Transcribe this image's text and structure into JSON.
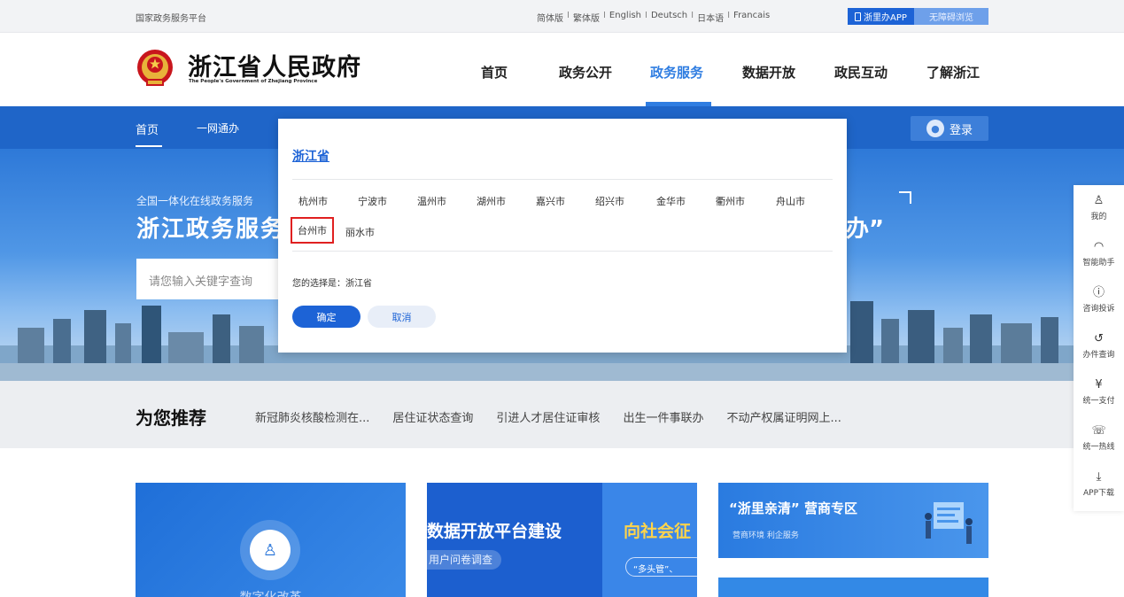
{
  "topbar": {
    "platform": "国家政务服务平台",
    "languages": [
      "简体版",
      "繁体版",
      "English",
      "Deutsch",
      "日本语",
      "Francais"
    ],
    "separator": "I",
    "app_label": "浙里办APP",
    "access_label": "无障碍浏览"
  },
  "header": {
    "site_name": "浙江省人民政府",
    "site_name_en": "The People's Government of Zhejiang Province",
    "nav": [
      "首页",
      "政务公开",
      "政务服务",
      "数据开放",
      "政民互动",
      "了解浙江"
    ],
    "active_nav": "政务服务"
  },
  "bluebar": {
    "items": [
      "首页",
      "一网通办"
    ],
    "login_label": "登录"
  },
  "banner": {
    "small": "全国一体化在线政务服务",
    "big": "浙江政务服务",
    "quote": "办”",
    "search_placeholder": "请您输入关键字查询"
  },
  "recommend": {
    "title": "为您推荐",
    "links": [
      "新冠肺炎核酸检测在...",
      "居住证状态查询",
      "引进人才居住证审核",
      "出生一件事联办",
      "不动产权属证明网上..."
    ]
  },
  "cards": {
    "card1_label": "数字化改革",
    "card2_title": "数据开放平台建设",
    "card2_sub": "用户问卷调查",
    "card2_right_title": "向社会征",
    "card2_right_sub": "“多头管”、",
    "card3_title": "“浙里亲清” 营商专区",
    "card3_sub": "营商环境 利企服务"
  },
  "sidefloat": [
    {
      "icon": "user-icon",
      "label": "我的"
    },
    {
      "icon": "headset-icon",
      "label": "智能助手"
    },
    {
      "icon": "alert-icon",
      "label": "咨询投诉"
    },
    {
      "icon": "history-icon",
      "label": "办件查询"
    },
    {
      "icon": "yuan-icon",
      "label": "统一支付"
    },
    {
      "icon": "phone-icon",
      "label": "统一热线"
    },
    {
      "icon": "download-icon",
      "label": "APP下载"
    }
  ],
  "modal": {
    "province": "浙江省",
    "cities": [
      "杭州市",
      "宁波市",
      "温州市",
      "湖州市",
      "嘉兴市",
      "绍兴市",
      "金华市",
      "衢州市",
      "舟山市",
      "台州市",
      "丽水市"
    ],
    "selected_city": "台州市",
    "choice_text": "您的选择是：浙江省",
    "ok_label": "确定",
    "cancel_label": "取消"
  },
  "colors": {
    "accent": "#1d63d6",
    "nav_active": "#2f7de1",
    "blue_bar": "#1f65c8",
    "selection_border": "#e02020"
  }
}
